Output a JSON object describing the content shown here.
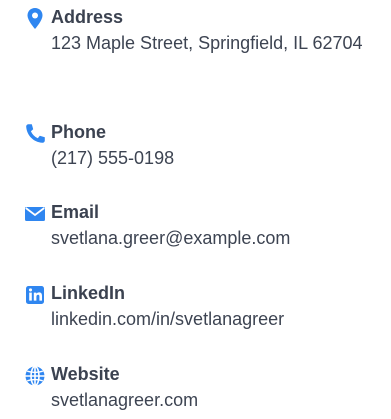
{
  "accent_color": "#2f86f0",
  "contact": {
    "items": [
      {
        "icon": "map-pin-icon",
        "label": "Address",
        "value": "123 Maple Street, Springfield, IL 62704"
      },
      {
        "icon": "phone-icon",
        "label": "Phone",
        "value": "(217) 555-0198"
      },
      {
        "icon": "envelope-icon",
        "label": "Email",
        "value": "svetlana.greer@example.com"
      },
      {
        "icon": "linkedin-icon",
        "label": "LinkedIn",
        "value": "linkedin.com/in/svetlanagreer"
      },
      {
        "icon": "globe-icon",
        "label": "Website",
        "value": "svetlanagreer.com"
      }
    ]
  }
}
